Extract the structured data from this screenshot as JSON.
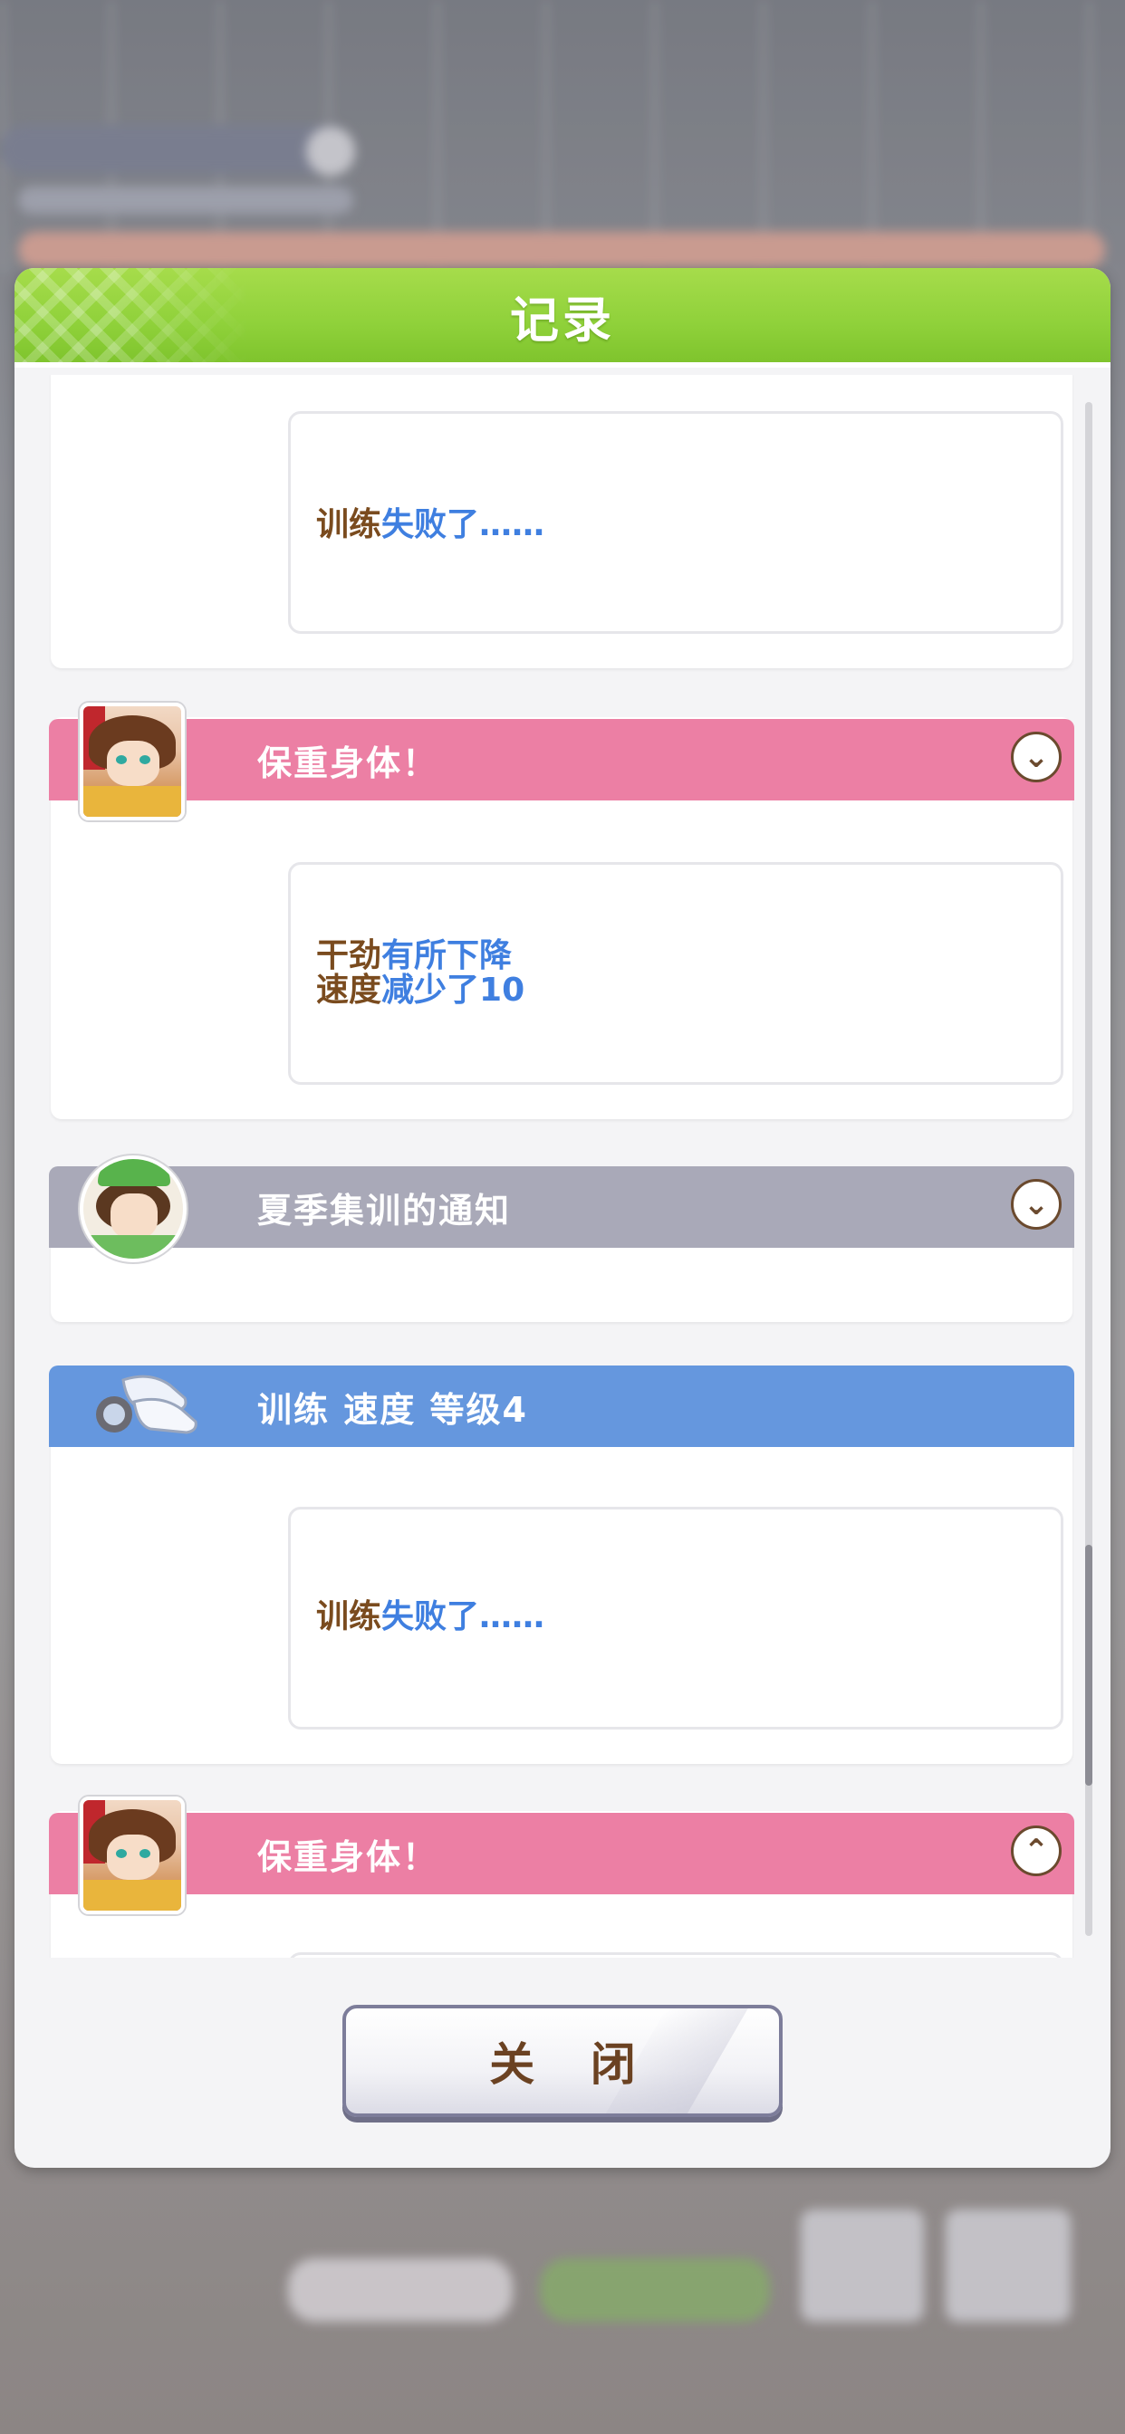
{
  "dialog": {
    "title": "记录",
    "close_label": "关 闭"
  },
  "log": [
    {
      "kind": "result-only",
      "lines": [
        [
          {
            "text": "训练",
            "tone": "brown"
          },
          {
            "text": "失败了……",
            "tone": "blue"
          }
        ]
      ]
    },
    {
      "kind": "event",
      "title": "保重身体！",
      "color": "pink",
      "chevron": "chevron-down-icon",
      "lines": [
        [
          {
            "text": "干劲",
            "tone": "brown"
          },
          {
            "text": "有所下降",
            "tone": "blue"
          }
        ],
        [
          {
            "text": "速度",
            "tone": "brown"
          },
          {
            "text": "减少了10",
            "tone": "blue"
          }
        ]
      ]
    },
    {
      "kind": "event",
      "title": "夏季集训的通知",
      "color": "gray",
      "chevron": "chevron-down-icon"
    },
    {
      "kind": "training",
      "title": "训练  速度  等级4",
      "color": "blue",
      "lines": [
        [
          {
            "text": "训练",
            "tone": "brown"
          },
          {
            "text": "失败了……",
            "tone": "blue"
          }
        ]
      ]
    },
    {
      "kind": "event",
      "title": "保重身体！",
      "color": "pink",
      "chevron": "chevron-up-icon"
    }
  ],
  "colors": {
    "header_green": "#8fd13a",
    "pink_band": "#ec7fa4",
    "gray_band": "#a9a9b8",
    "blue_band": "#6597de",
    "text_brown": "#7a4b1e",
    "text_blue": "#3f7fe0"
  }
}
